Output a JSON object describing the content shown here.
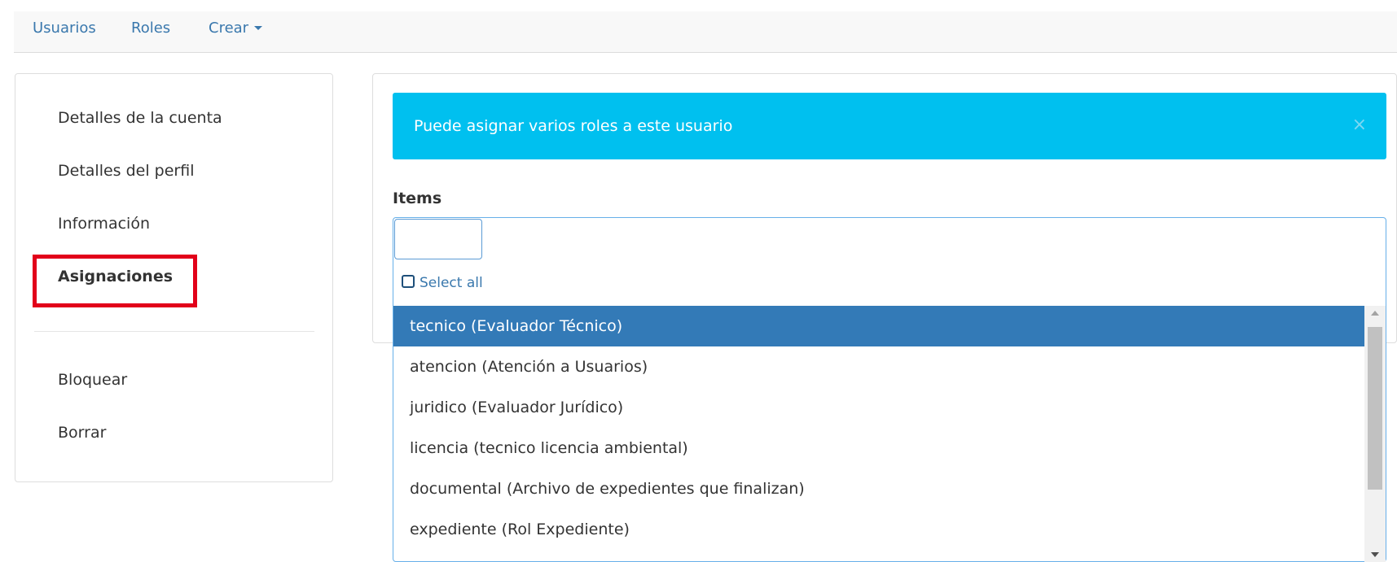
{
  "nav": {
    "items": [
      {
        "label": "Usuarios"
      },
      {
        "label": "Roles"
      },
      {
        "label": "Crear",
        "has_dropdown": true
      }
    ]
  },
  "sidebar": {
    "items": [
      {
        "label": "Detalles de la cuenta"
      },
      {
        "label": "Detalles del perfil"
      },
      {
        "label": "Información"
      },
      {
        "label": "Asignaciones",
        "active": true
      },
      {
        "label": "Bloquear"
      },
      {
        "label": "Borrar"
      }
    ]
  },
  "alert": {
    "text": "Puede asignar varios roles a este usuario",
    "close_icon": "×",
    "color": "#00c0ef"
  },
  "form": {
    "items_label": "Items",
    "search_value": "",
    "select_all_label": "Select all"
  },
  "options": [
    {
      "label": "tecnico (Evaluador Técnico)",
      "selected": true
    },
    {
      "label": "atencion (Atención a Usuarios)"
    },
    {
      "label": "juridico (Evaluador Jurídico)"
    },
    {
      "label": "licencia (tecnico licencia ambiental)"
    },
    {
      "label": "documental (Archivo de expedientes que finalizan)"
    },
    {
      "label": "expediente (Rol Expediente)"
    }
  ],
  "colors": {
    "link": "#3a78ad",
    "selected_option": "#337ab7",
    "highlight_box": "#e2001a"
  }
}
